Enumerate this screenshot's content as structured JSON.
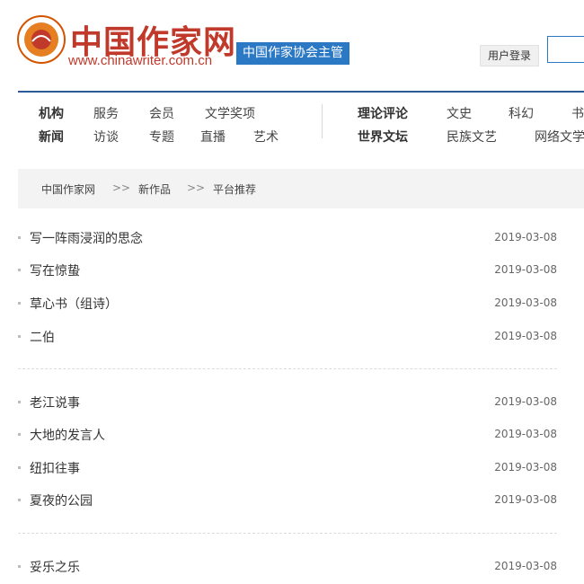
{
  "header": {
    "logo_title": "中国作家网",
    "logo_url": "www.chinawriter.com.cn",
    "tag": "中国作家协会主管",
    "login_label": "用户登录"
  },
  "nav": {
    "row1_left": [
      "机构",
      "服务",
      "会员",
      "文学奖项"
    ],
    "row2_left": [
      "新闻",
      "访谈",
      "专题",
      "直播",
      "艺术"
    ],
    "row1_right": [
      "理论评论",
      "文史",
      "科幻",
      "书"
    ],
    "row2_right": [
      "世界文坛",
      "民族文艺",
      "网络文学"
    ]
  },
  "breadcrumb": [
    "中国作家网",
    "新作品",
    "平台推荐"
  ],
  "breadcrumb_sep": ">>",
  "articles": [
    {
      "title": "写一阵雨浸润的思念",
      "date": "2019-03-08"
    },
    {
      "title": "写在惊蛰",
      "date": "2019-03-08"
    },
    {
      "title": "草心书（组诗）",
      "date": "2019-03-08"
    },
    {
      "title": "二伯",
      "date": "2019-03-08"
    },
    {
      "title": "老江说事",
      "date": "2019-03-08"
    },
    {
      "title": "大地的发言人",
      "date": "2019-03-08"
    },
    {
      "title": "纽扣往事",
      "date": "2019-03-08"
    },
    {
      "title": "夏夜的公园",
      "date": "2019-03-08"
    },
    {
      "title": "妥乐之乐",
      "date": "2019-03-08"
    }
  ],
  "colors": {
    "brand_red": "#c0392b",
    "brand_blue": "#2b78c4",
    "rule": "#2b5a99"
  }
}
